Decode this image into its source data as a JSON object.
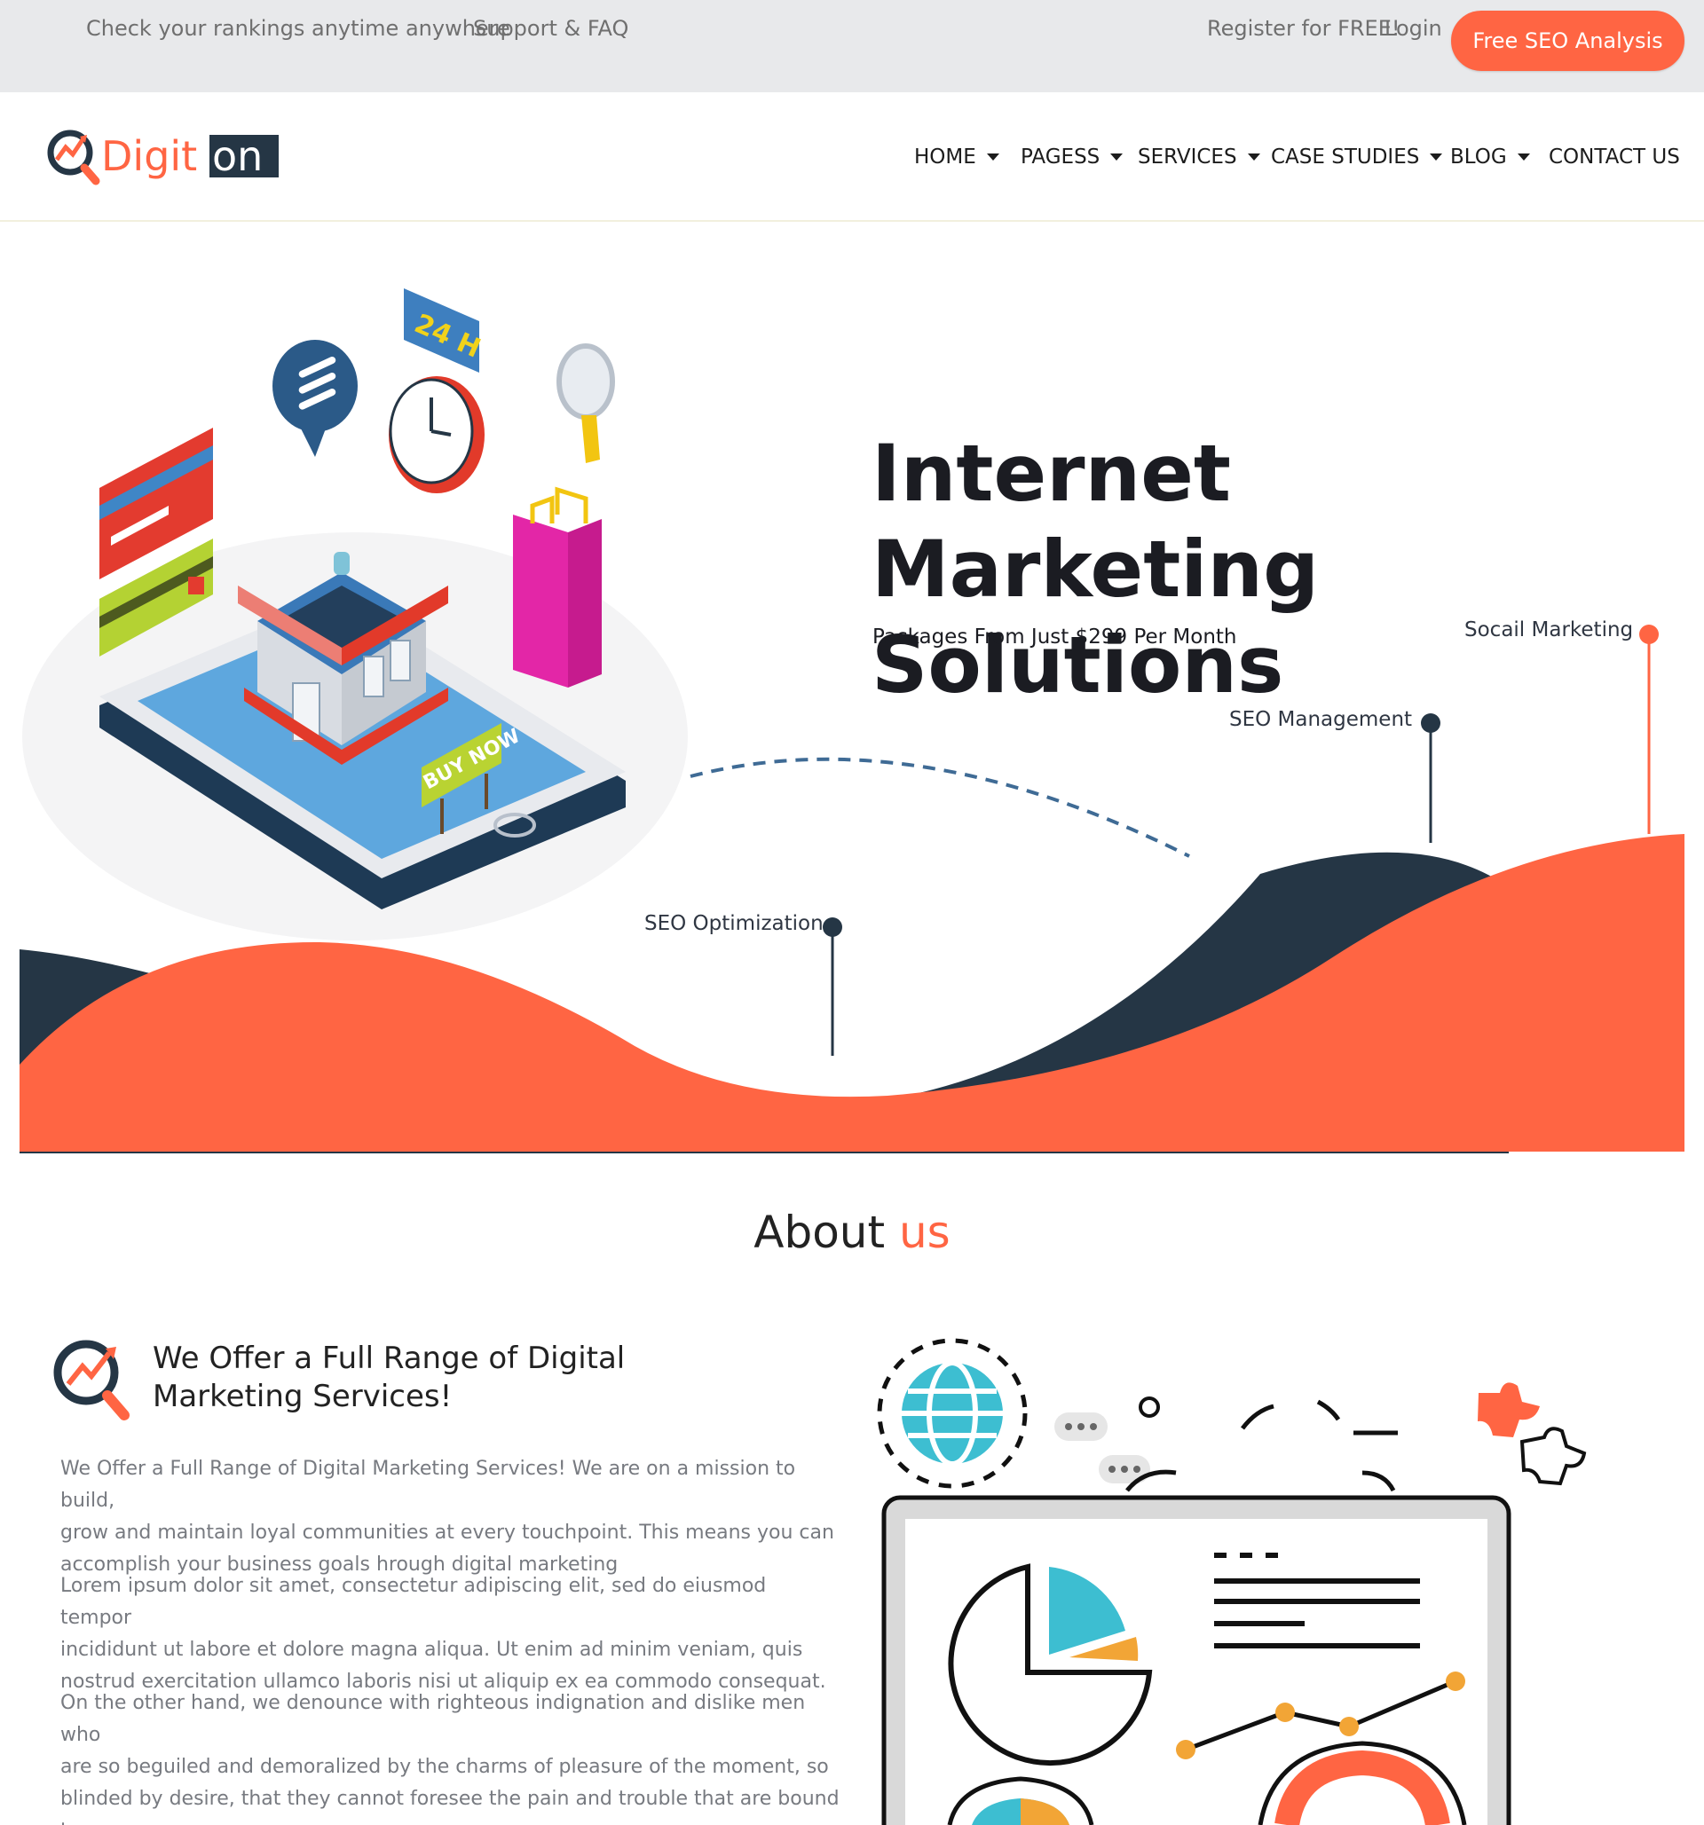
{
  "topbar": {
    "tagline": "Check your rankings anytime anywhere",
    "support": "Support & FAQ",
    "register": "Register for FREE!",
    "login": "Login",
    "cta": "Free SEO Analysis"
  },
  "header": {
    "logo_text_1": "Digit",
    "logo_text_2": "on",
    "nav": [
      {
        "label": "HOME",
        "dropdown": true
      },
      {
        "label": "PAGESS",
        "dropdown": true
      },
      {
        "label": "SERVICES",
        "dropdown": true
      },
      {
        "label": "CASE STUDIES",
        "dropdown": true
      },
      {
        "label": "BLOG",
        "dropdown": true
      },
      {
        "label": "CONTACT US",
        "dropdown": false
      }
    ]
  },
  "hero": {
    "title_line1": "Internet Marketing",
    "title_line2": "Solutions",
    "subtitle": "Packages From Just $299 Per Month",
    "pins": {
      "social": "Socail Marketing",
      "seo_management": "SEO Management",
      "seo_optimization": "SEO Optimization"
    },
    "illustration": {
      "clock_badge": "24 H",
      "sign": "BUY NOW"
    }
  },
  "about": {
    "title_main": "About",
    "title_accent": "us",
    "heading_line1": "We Offer a Full Range of Digital",
    "heading_line2": "Marketing Services!",
    "paragraph1_lines": [
      "We Offer a Full Range of Digital Marketing Services! We are on a mission to build,",
      "grow and maintain loyal communities at every touchpoint. This means you can",
      "accomplish your business goals hrough digital marketing"
    ],
    "paragraph2_lines": [
      "Lorem ipsum dolor sit amet, consectetur adipiscing elit, sed do eiusmod tempor",
      "incididunt ut labore et dolore magna aliqua. Ut enim ad minim veniam, quis",
      "nostrud exercitation ullamco laboris nisi ut aliquip ex ea commodo consequat."
    ],
    "paragraph3_lines": [
      "On the other hand, we denounce with righteous indignation and dislike men who",
      "are so beguiled and demoralized by the charms of pleasure of the moment, so",
      "blinded by desire, that they cannot foresee the pain and trouble that are bound to",
      "ensue"
    ]
  },
  "colors": {
    "accent": "#ff6543",
    "navy": "#253645",
    "topbar_bg": "#e8e9eb",
    "text_muted": "#777a80"
  }
}
